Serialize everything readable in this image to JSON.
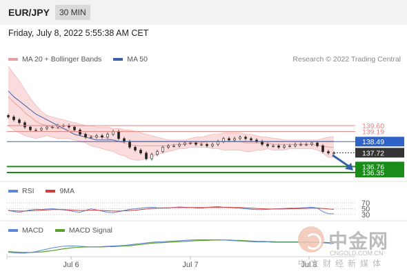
{
  "header": {
    "symbol": "EUR/JPY",
    "timeframe": "30 MIN"
  },
  "timestamp": "Friday, July 8, 2022 5:55:38 AM CET",
  "legend": {
    "ma20_label": "MA 20 + Bollinger Bands",
    "ma50_label": "MA 50",
    "copyright": "Research © 2022 Trading Central"
  },
  "colors": {
    "ma20": "#e8a0a0",
    "bollinger_fill": "#fbdcdc",
    "ma50": "#3b5fa8",
    "level_red": "#e88080",
    "level_blue": "#2f63c8",
    "level_green": "#1a8c1a",
    "arrow": "#3563a8",
    "rsi": "#5b86d9",
    "rsi_ma": "#d33a3a",
    "macd": "#5b86d9",
    "macd_signal": "#5aa02c"
  },
  "rsi_legend": {
    "rsi_label": "RSI",
    "ma_label": "9MA"
  },
  "rsi_levels": [
    "70",
    "50",
    "30"
  ],
  "macd_legend": {
    "macd_label": "MACD",
    "signal_label": "MACD Signal"
  },
  "x_ticks": [
    "Jul 6",
    "Jul 7",
    "Jul 8"
  ],
  "watermark": {
    "cn": "中金网",
    "en": "CNGOLD.COM.CN",
    "sub": "中文财经新媒体"
  },
  "chart_data": [
    {
      "type": "line",
      "title": "EUR/JPY",
      "levels": [
        {
          "label": "139.60",
          "value": 139.6,
          "color": "red"
        },
        {
          "label": "139.19",
          "value": 139.19,
          "color": "red"
        },
        {
          "label": "138.49",
          "value": 138.49,
          "color": "blue"
        },
        {
          "label": "137.72",
          "value": 137.72,
          "color": "dark"
        },
        {
          "label": "136.76",
          "value": 136.76,
          "color": "green"
        },
        {
          "label": "136.35",
          "value": 136.35,
          "color": "green"
        }
      ],
      "current_price": 137.72,
      "close": [
        140.2,
        140.0,
        139.8,
        139.5,
        139.3,
        139.3,
        139.4,
        139.5,
        139.5,
        139.6,
        139.6,
        139.5,
        139.3,
        139.0,
        138.8,
        138.8,
        138.9,
        138.8,
        139.0,
        139.2,
        138.7,
        138.5,
        138.1,
        137.9,
        137.7,
        137.3,
        137.6,
        137.8,
        138.1,
        138.2,
        138.2,
        138.3,
        138.4,
        138.4,
        138.3,
        138.3,
        138.2,
        138.3,
        138.5,
        138.7,
        138.6,
        138.7,
        138.8,
        138.7,
        138.6,
        138.5,
        138.3,
        138.2,
        138.2,
        138.1,
        138.2,
        138.2,
        138.3,
        138.3,
        138.3,
        138.4,
        138.2,
        137.8,
        137.7,
        137.7
      ],
      "ma20": [
        141.6,
        141.2,
        140.9,
        140.5,
        140.2,
        139.9,
        139.7,
        139.6,
        139.5,
        139.4,
        139.4,
        139.3,
        139.2,
        139.1,
        139.0,
        138.9,
        138.8,
        138.8,
        138.7,
        138.6,
        138.5,
        138.4,
        138.3,
        138.2,
        138.2,
        138.2,
        138.2,
        138.2,
        138.2,
        138.2,
        138.3,
        138.3,
        138.3,
        138.4,
        138.4,
        138.4,
        138.5,
        138.5,
        138.5,
        138.5,
        138.5,
        138.5,
        138.5,
        138.4,
        138.4,
        138.4,
        138.4,
        138.4,
        138.3,
        138.3,
        138.3,
        138.3,
        138.3,
        138.3,
        138.3,
        138.3,
        138.2,
        138.2,
        138.1,
        138.1
      ],
      "ma50": [
        142.0,
        141.6,
        141.3,
        141.0,
        140.7,
        140.4,
        140.2,
        140.0,
        139.8,
        139.6,
        139.4,
        139.2,
        139.0,
        138.9,
        138.8,
        138.7,
        138.6,
        138.6,
        138.6,
        138.6,
        138.5,
        138.5,
        138.5,
        138.5,
        138.5,
        138.5,
        138.5,
        138.5,
        138.5,
        138.5,
        138.5,
        138.5,
        138.5,
        138.5,
        138.5,
        138.5,
        138.5,
        138.5,
        138.5,
        138.5,
        138.5,
        138.5,
        138.5,
        138.5,
        138.5,
        138.5,
        138.5,
        138.5,
        138.5,
        138.5,
        138.5,
        138.5,
        138.5,
        138.5,
        138.5,
        138.5,
        138.5,
        138.5,
        138.5,
        138.5
      ],
      "bb_upper": [
        143.7,
        143.2,
        142.7,
        142.1,
        141.5,
        141.0,
        140.6,
        140.3,
        140.2,
        140.1,
        140.0,
        139.9,
        139.8,
        139.7,
        139.6,
        139.6,
        139.5,
        139.5,
        139.5,
        139.4,
        139.4,
        139.3,
        139.3,
        139.2,
        139.1,
        139.0,
        138.9,
        138.8,
        138.7,
        138.6,
        138.6,
        138.6,
        138.6,
        138.7,
        138.8,
        138.8,
        138.9,
        139.0,
        139.0,
        139.1,
        139.1,
        139.1,
        139.1,
        139.0,
        139.0,
        138.9,
        138.8,
        138.8,
        138.7,
        138.7,
        138.6,
        138.6,
        138.6,
        138.6,
        138.6,
        138.6,
        138.6,
        138.7,
        138.8,
        138.8
      ],
      "bb_lower": [
        139.6,
        139.3,
        139.1,
        138.9,
        138.8,
        138.7,
        138.8,
        138.9,
        138.8,
        138.7,
        138.7,
        138.7,
        138.6,
        138.5,
        138.4,
        138.2,
        138.1,
        138.0,
        137.9,
        137.8,
        137.6,
        137.5,
        137.3,
        137.2,
        137.2,
        137.3,
        137.4,
        137.6,
        137.7,
        137.8,
        137.9,
        138.0,
        138.0,
        138.1,
        138.1,
        138.1,
        138.1,
        138.0,
        138.0,
        137.9,
        137.9,
        137.9,
        137.9,
        137.8,
        137.8,
        137.9,
        137.9,
        138.0,
        137.9,
        137.9,
        137.9,
        138.0,
        138.0,
        138.0,
        138.0,
        138.0,
        137.9,
        137.7,
        137.4,
        137.4
      ],
      "ylim": [
        135.9,
        144.2
      ]
    },
    {
      "type": "line",
      "title": "RSI",
      "levels": [
        70,
        50,
        30
      ],
      "series": [
        {
          "name": "RSI",
          "values": [
            45,
            40,
            38,
            42,
            46,
            48,
            47,
            49,
            50,
            48,
            46,
            44,
            40,
            38,
            44,
            50,
            46,
            42,
            38,
            36,
            40,
            44,
            48,
            50,
            52,
            54,
            55,
            53,
            52,
            53,
            54,
            56,
            55,
            54,
            53,
            52,
            54,
            56,
            57,
            55,
            54,
            53,
            52,
            50,
            48,
            47,
            47,
            48,
            49,
            50,
            51,
            52,
            52,
            53,
            54,
            55,
            52,
            40,
            33,
            33
          ]
        },
        {
          "name": "9MA",
          "values": [
            44,
            43,
            42,
            42,
            43,
            44,
            45,
            46,
            47,
            47,
            47,
            46,
            45,
            44,
            44,
            45,
            45,
            44,
            43,
            42,
            42,
            43,
            44,
            45,
            47,
            49,
            51,
            52,
            53,
            53,
            54,
            54,
            54,
            54,
            54,
            54,
            54,
            55,
            55,
            55,
            55,
            54,
            54,
            53,
            52,
            51,
            50,
            49,
            49,
            49,
            49,
            50,
            50,
            51,
            51,
            52,
            52,
            51,
            49,
            48
          ]
        }
      ],
      "ylim": [
        20,
        80
      ]
    },
    {
      "type": "line",
      "title": "MACD",
      "series": [
        {
          "name": "MACD",
          "values": [
            -0.3,
            -0.32,
            -0.33,
            -0.33,
            -0.31,
            -0.28,
            -0.24,
            -0.2,
            -0.16,
            -0.13,
            -0.11,
            -0.1,
            -0.1,
            -0.11,
            -0.12,
            -0.13,
            -0.13,
            -0.12,
            -0.11,
            -0.1,
            -0.09,
            -0.08,
            -0.06,
            -0.04,
            -0.02,
            0.0,
            0.02,
            0.03,
            0.04,
            0.05,
            0.06,
            0.07,
            0.08,
            0.09,
            0.1,
            0.1,
            0.1,
            0.1,
            0.1,
            0.09,
            0.08,
            0.07,
            0.06,
            0.05,
            0.04,
            0.03,
            0.03,
            0.03,
            0.02,
            0.02,
            0.02,
            0.02,
            0.02,
            0.02,
            0.02,
            0.02,
            0.01,
            0.0,
            -0.01,
            -0.02
          ]
        },
        {
          "name": "MACD Signal",
          "values": [
            -0.28,
            -0.29,
            -0.3,
            -0.31,
            -0.31,
            -0.3,
            -0.29,
            -0.27,
            -0.25,
            -0.22,
            -0.19,
            -0.17,
            -0.15,
            -0.14,
            -0.13,
            -0.13,
            -0.13,
            -0.13,
            -0.12,
            -0.12,
            -0.11,
            -0.1,
            -0.09,
            -0.07,
            -0.05,
            -0.03,
            -0.01,
            0.0,
            0.01,
            0.02,
            0.03,
            0.04,
            0.05,
            0.06,
            0.07,
            0.08,
            0.08,
            0.09,
            0.09,
            0.09,
            0.09,
            0.08,
            0.08,
            0.07,
            0.06,
            0.05,
            0.05,
            0.04,
            0.04,
            0.03,
            0.03,
            0.03,
            0.03,
            0.03,
            0.03,
            0.02,
            0.02,
            0.02,
            0.01,
            0.01
          ]
        }
      ],
      "ylim": [
        -0.45,
        0.25
      ]
    }
  ]
}
